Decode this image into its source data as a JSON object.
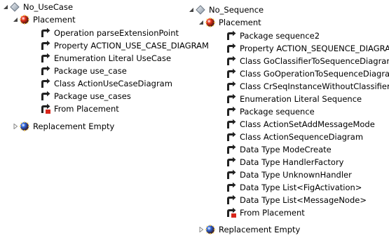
{
  "left_tree": {
    "root": {
      "label": "No_UseCase",
      "icon": "diamond-node-icon",
      "state": "expanded"
    },
    "placement": {
      "label": "Placement",
      "icon": "placement-ball-icon",
      "state": "expanded"
    },
    "children": [
      {
        "label": "Operation parseExtensionPoint",
        "icon": "element-arrow-icon"
      },
      {
        "label": "Property ACTION_USE_CASE_DIAGRAM",
        "icon": "element-arrow-icon"
      },
      {
        "label": "Enumeration Literal UseCase",
        "icon": "element-arrow-icon"
      },
      {
        "label": "Package use_case",
        "icon": "element-arrow-icon"
      },
      {
        "label": "Class ActionUseCaseDiagram",
        "icon": "element-arrow-icon"
      },
      {
        "label": "Package use_cases",
        "icon": "element-arrow-icon"
      },
      {
        "label": "From Placement",
        "icon": "from-placement-icon"
      }
    ],
    "replacement": {
      "label": "Replacement Empty",
      "icon": "replacement-ball-icon",
      "state": "collapsed"
    }
  },
  "right_tree": {
    "root": {
      "label": "No_Sequence",
      "icon": "diamond-node-icon",
      "state": "expanded"
    },
    "placement": {
      "label": "Placement",
      "icon": "placement-ball-icon",
      "state": "expanded"
    },
    "children": [
      {
        "label": "Package sequence2",
        "icon": "element-arrow-icon"
      },
      {
        "label": "Property ACTION_SEQUENCE_DIAGRAM",
        "icon": "element-arrow-icon"
      },
      {
        "label": "Class GoClassifierToSequenceDiagram",
        "icon": "element-arrow-icon"
      },
      {
        "label": "Class GoOperationToSequenceDiagram",
        "icon": "element-arrow-icon"
      },
      {
        "label": "Class CrSeqInstanceWithoutClassifier",
        "icon": "element-arrow-icon"
      },
      {
        "label": "Enumeration Literal Sequence",
        "icon": "element-arrow-icon"
      },
      {
        "label": "Package sequence",
        "icon": "element-arrow-icon"
      },
      {
        "label": "Class ActionSetAddMessageMode",
        "icon": "element-arrow-icon"
      },
      {
        "label": "Class ActionSequenceDiagram",
        "icon": "element-arrow-icon"
      },
      {
        "label": "Data Type ModeCreate",
        "icon": "element-arrow-icon"
      },
      {
        "label": "Data Type HandlerFactory",
        "icon": "element-arrow-icon"
      },
      {
        "label": "Data Type UnknownHandler",
        "icon": "element-arrow-icon"
      },
      {
        "label": "Data Type List<FigActivation>",
        "icon": "element-arrow-icon"
      },
      {
        "label": "Data Type List<MessageNode>",
        "icon": "element-arrow-icon"
      },
      {
        "label": "From Placement",
        "icon": "from-placement-icon"
      }
    ],
    "replacement": {
      "label": "Replacement Empty",
      "icon": "replacement-ball-icon",
      "state": "collapsed"
    }
  },
  "colors": {
    "diamond": "#8a97a6",
    "placement_ball": "#e8321c",
    "replacement_ball": "#2b63d9",
    "arrow_icon": "#222222",
    "twisty": "#444444"
  }
}
